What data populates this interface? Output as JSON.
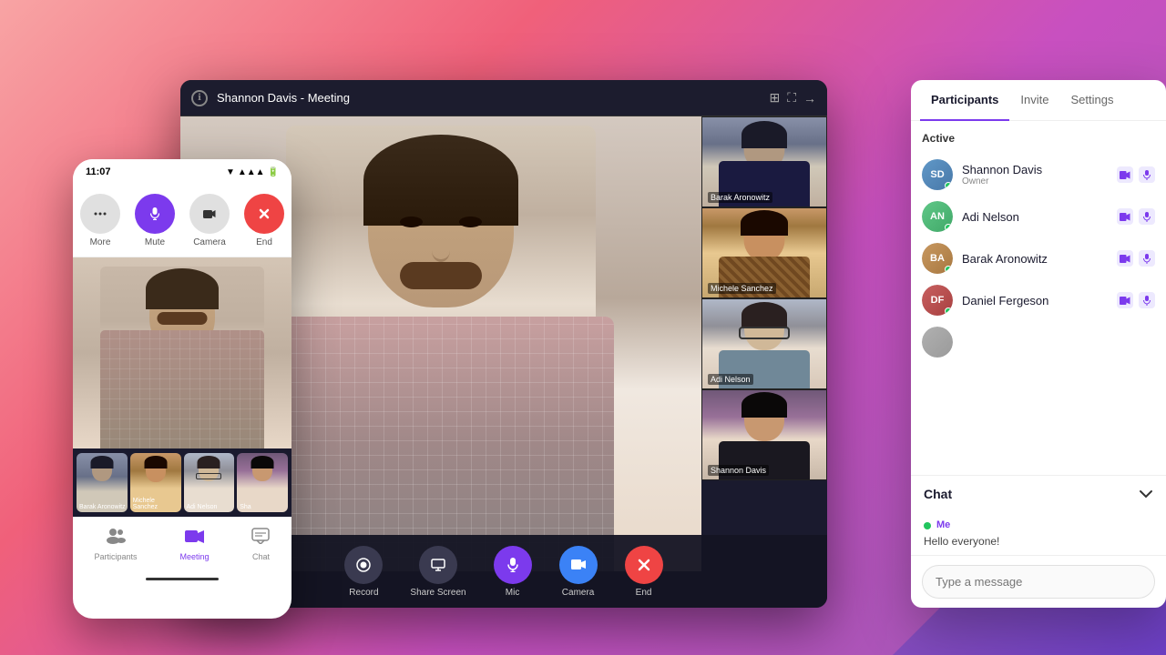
{
  "background": {
    "gradient": "pink to purple"
  },
  "meeting_window": {
    "title": "Shannon Davis - Meeting",
    "controls": [
      "grid-view",
      "fullscreen",
      "more-options"
    ]
  },
  "video_thumbs": [
    {
      "id": "thumb-1",
      "label": "Barak Aronowitz",
      "person_class": "thumb-person-1"
    },
    {
      "id": "thumb-2",
      "label": "Michele Sanchez",
      "person_class": "thumb-person-2"
    },
    {
      "id": "thumb-3",
      "label": "Adi Nelson",
      "person_class": "thumb-person-3"
    },
    {
      "id": "thumb-4",
      "label": "Shannon Davis",
      "person_class": "thumb-person-4"
    }
  ],
  "bottom_controls": [
    {
      "id": "record",
      "label": "Record",
      "icon": "⏺",
      "class": "btn-dark"
    },
    {
      "id": "share-screen",
      "label": "Share Screen",
      "icon": "🖥",
      "class": "btn-dark"
    },
    {
      "id": "mic",
      "label": "Mic",
      "icon": "🎤",
      "class": "btn-purple"
    },
    {
      "id": "camera",
      "label": "Camera",
      "icon": "📹",
      "class": "btn-blue"
    },
    {
      "id": "end",
      "label": "End",
      "icon": "✕",
      "class": "btn-red"
    }
  ],
  "right_panel": {
    "tabs": [
      {
        "id": "participants",
        "label": "Participants",
        "active": true
      },
      {
        "id": "invite",
        "label": "Invite",
        "active": false
      },
      {
        "id": "settings",
        "label": "Settings",
        "active": false
      }
    ],
    "active_section": "Active",
    "participants": [
      {
        "id": "p1",
        "name": "Shannon Davis",
        "role": "Owner",
        "av_class": "av-blue",
        "initials": "SD",
        "online": true
      },
      {
        "id": "p2",
        "name": "Adi Nelson",
        "role": "",
        "av_class": "av-green",
        "initials": "AN",
        "online": true
      },
      {
        "id": "p3",
        "name": "Barak Aronowitz",
        "role": "",
        "av_class": "av-orange",
        "initials": "BA",
        "online": true
      },
      {
        "id": "p4",
        "name": "Daniel Fergeson",
        "role": "",
        "av_class": "av-red",
        "initials": "DF",
        "online": true
      },
      {
        "id": "p5",
        "name": "",
        "role": "",
        "av_class": "av-gray",
        "initials": "",
        "online": false
      }
    ],
    "chat": {
      "title": "Chat",
      "messages": [
        {
          "sender": "Me",
          "text": "Hello everyone!"
        }
      ],
      "input_placeholder": "Type a message"
    }
  },
  "phone": {
    "status_bar": {
      "time": "11:07",
      "signal_icon": "▼",
      "icons": "📶🔋"
    },
    "controls": [
      {
        "id": "more",
        "label": "More",
        "icon": "⋮",
        "class": "btn-dark"
      },
      {
        "id": "mute",
        "label": "Mute",
        "icon": "🎤",
        "class": "btn-purple"
      },
      {
        "id": "camera-ph",
        "label": "Camera",
        "icon": "📷",
        "class": "btn-dark"
      },
      {
        "id": "end-ph",
        "label": "End",
        "icon": "✕",
        "class": "btn-red"
      }
    ],
    "thumbnails": [
      {
        "id": "ph-thumb-1",
        "label": "Barak Aronowitz",
        "class": "thumb-person-1"
      },
      {
        "id": "ph-thumb-2",
        "label": "Michele Sanchez",
        "class": "thumb-person-2"
      },
      {
        "id": "ph-thumb-3",
        "label": "Adi Nelson",
        "class": "thumb-person-3"
      },
      {
        "id": "ph-thumb-4",
        "label": "Sha",
        "class": "thumb-person-4"
      }
    ],
    "bottom_nav": [
      {
        "id": "nav-participants",
        "label": "Participants",
        "icon": "👥",
        "active": false
      },
      {
        "id": "nav-meeting",
        "label": "Meeting",
        "icon": "📹",
        "active": true
      },
      {
        "id": "nav-chat",
        "label": "Chat",
        "icon": "💬",
        "active": false
      }
    ]
  }
}
